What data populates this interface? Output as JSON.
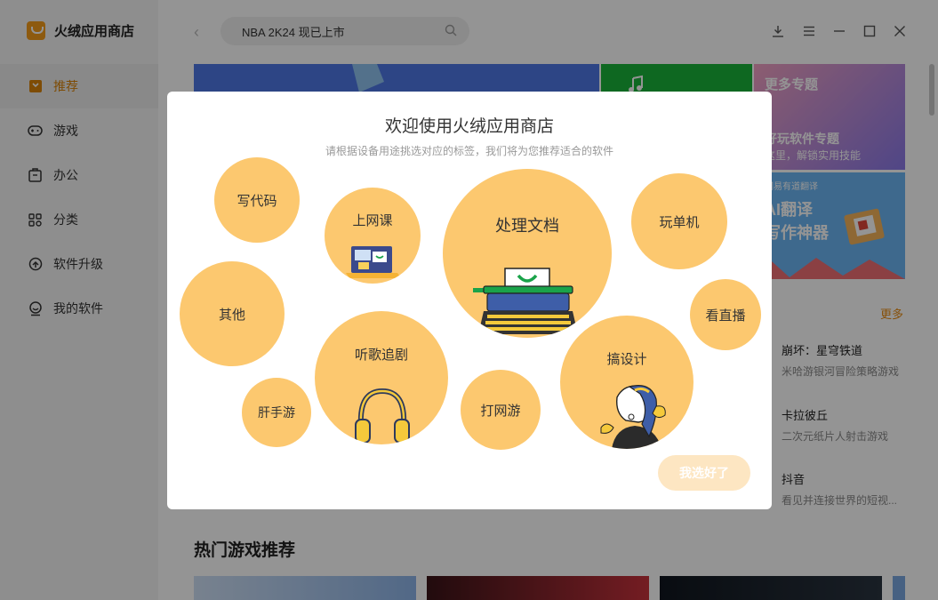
{
  "app": {
    "title": "火绒应用商店"
  },
  "sidebar": {
    "items": [
      {
        "label": "推荐",
        "icon": "bookmark-icon",
        "active": true
      },
      {
        "label": "游戏",
        "icon": "gamepad-icon"
      },
      {
        "label": "办公",
        "icon": "briefcase-icon"
      },
      {
        "label": "分类",
        "icon": "grid-icon"
      },
      {
        "label": "软件升级",
        "icon": "upgrade-icon"
      },
      {
        "label": "我的软件",
        "icon": "smiley-icon"
      }
    ]
  },
  "search": {
    "value": "NBA 2K24  现已上市"
  },
  "banners": {
    "topic_title": "更多专题",
    "topic_sub1": "好玩软件专题",
    "topic_sub2": "这里，解锁实用技能",
    "ai_tag": "网易有道翻译",
    "ai_title1": "AI翻译",
    "ai_title2": "写作神器"
  },
  "right_list": {
    "more": "更多",
    "apps": [
      {
        "name": "崩坏：星穹铁道",
        "desc": "米哈游银河冒险策略游戏"
      },
      {
        "name": "卡拉彼丘",
        "desc": "二次元纸片人射击游戏"
      },
      {
        "name": "抖音",
        "desc": "看见并连接世界的短视..."
      }
    ]
  },
  "section": {
    "title": "热门游戏推荐"
  },
  "modal": {
    "title": "欢迎使用火绒应用商店",
    "subtitle": "请根据设备用途挑选对应的标签，我们将为您推荐适合的软件",
    "tags": [
      "写代码",
      "上网课",
      "处理文档",
      "玩单机",
      "其他",
      "看直播",
      "听歌追剧",
      "搞设计",
      "肝手游",
      "打网游"
    ],
    "confirm": "我选好了"
  },
  "colors": {
    "accent": "#e88a10",
    "bubble": "#fcc86f",
    "confirm_disabled": "#fde6c2"
  }
}
